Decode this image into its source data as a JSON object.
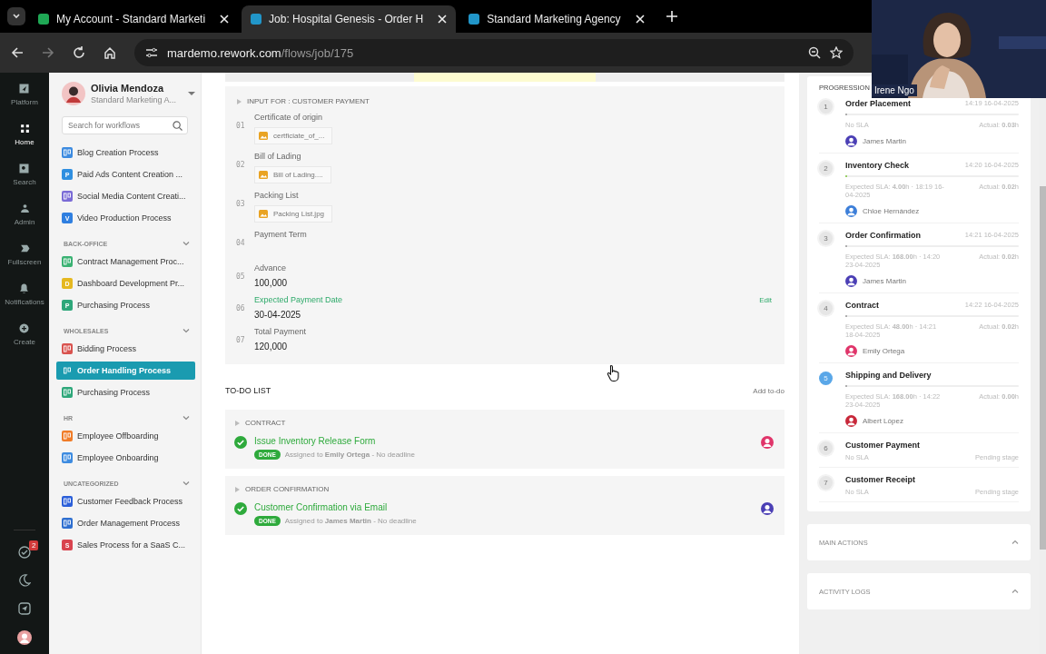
{
  "browser": {
    "tabs": [
      {
        "title": "My Account - Standard Marketi",
        "selected": false,
        "color": "#1fa855"
      },
      {
        "title": "Job: Hospital Genesis - Order H",
        "selected": true,
        "color": "#2196c9"
      },
      {
        "title": "Standard Marketing Agency",
        "selected": false,
        "color": "#2196c9"
      }
    ],
    "url": {
      "host": "mardemo.rework.com",
      "path": "/flows/job/175"
    }
  },
  "webcam": {
    "name": "Irene Ngo"
  },
  "rail": {
    "items": [
      {
        "label": "Platform",
        "selected": false
      },
      {
        "label": "Home",
        "selected": true
      },
      {
        "label": "Search",
        "selected": false
      },
      {
        "label": "Admin",
        "selected": false
      },
      {
        "label": "Fullscreen",
        "selected": false
      },
      {
        "label": "Notifications",
        "selected": false
      },
      {
        "label": "Create",
        "selected": false
      }
    ],
    "task_count": "2"
  },
  "sidebar": {
    "user": {
      "name": "Olivia Mendoza",
      "org": "Standard Marketing A..."
    },
    "search": {
      "placeholder": "Search for workflows"
    },
    "groups": [
      {
        "items": [
          {
            "label": "Blog Creation Process",
            "selected": false,
            "color": "#3d8be0"
          },
          {
            "label": "Paid Ads Content Creation ...",
            "selected": false,
            "color": "#2f8fe0",
            "letter": "P"
          },
          {
            "label": "Social Media Content Creati...",
            "selected": false,
            "color": "#7a6bd6"
          },
          {
            "label": "Video Production Process",
            "selected": false,
            "color": "#2f7fe0",
            "letter": "V"
          }
        ]
      },
      {
        "title": "BACK-OFFICE",
        "items": [
          {
            "label": "Contract Management Proc...",
            "selected": false,
            "color": "#3bb273"
          },
          {
            "label": "Dashboard Development Pr...",
            "selected": false,
            "color": "#e5b820",
            "letter": "D"
          },
          {
            "label": "Purchasing Process",
            "selected": false,
            "color": "#2ea77a",
            "letter": "P"
          }
        ]
      },
      {
        "title": "WHOLESALES",
        "items": [
          {
            "label": "Bidding Process",
            "selected": false,
            "color": "#d9534f"
          },
          {
            "label": "Order Handling Process",
            "selected": true
          },
          {
            "label": "Purchasing Process",
            "selected": false,
            "color": "#2ea77a"
          }
        ]
      },
      {
        "title": "HR",
        "items": [
          {
            "label": "Employee Offboarding",
            "selected": false,
            "color": "#f07c28"
          },
          {
            "label": "Employee Onboarding",
            "selected": false,
            "color": "#3d8be0"
          }
        ]
      },
      {
        "title": "UNCATEGORIZED",
        "items": [
          {
            "label": "Customer Feedback Process",
            "selected": false,
            "color": "#2b5fd9"
          },
          {
            "label": "Order Management Process",
            "selected": false,
            "color": "#2f6fd0"
          },
          {
            "label": "Sales Process for a SaaS C...",
            "selected": false,
            "color": "#d9444f",
            "letter": "S"
          }
        ]
      }
    ]
  },
  "input_section": {
    "title": "INPUT FOR : CUSTOMER PAYMENT",
    "fields": [
      {
        "number": "01",
        "label": "Certificate of origin",
        "kind": "file",
        "file": "certficiate_of_..."
      },
      {
        "number": "02",
        "label": "Bill of Lading",
        "kind": "file",
        "file": "Bill of Lading...."
      },
      {
        "number": "03",
        "label": "Packing List",
        "kind": "file",
        "file": "Packing List.jpg"
      },
      {
        "number": "04",
        "label": "Payment Term",
        "kind": "empty"
      },
      {
        "number": "05",
        "label": "Advance",
        "kind": "value",
        "value": "100,000"
      },
      {
        "number": "06",
        "label": "Expected Payment Date",
        "kind": "value",
        "value": "30-04-2025",
        "highlighted": true,
        "action": "Edit"
      },
      {
        "number": "07",
        "label": "Total Payment",
        "kind": "value",
        "value": "120,000"
      }
    ]
  },
  "todo": {
    "title": "TO-DO LIST",
    "add": "Add to-do",
    "groups": [
      {
        "stage": "CONTRACT",
        "items": [
          {
            "title": "Issue Inventory Release Form",
            "done": true,
            "status": "DONE",
            "assigned": "Assigned to **Emily Ortega** - No deadline",
            "color": "#e0356a"
          }
        ]
      },
      {
        "stage": "ORDER CONFIRMATION",
        "items": [
          {
            "title": "Customer Confirmation via Email",
            "done": true,
            "status": "DONE",
            "assigned": "Assigned to **James Martin** - No deadline",
            "color": "#4b3fb5"
          }
        ]
      }
    ]
  },
  "progression": {
    "title": "PROGRESSION",
    "stages": [
      {
        "number": "1",
        "name": "Order Placement",
        "current": false,
        "time": "14:19 16-04-2025",
        "level": 0,
        "sla": "No SLA",
        "actual": "Actual: **0.03**h",
        "assignee": "James Martin",
        "color": "#4b3fb5"
      },
      {
        "number": "2",
        "name": "Inventory Check",
        "current": false,
        "time": "14:20 16-04-2025",
        "level": 0.01,
        "sla": "Expected SLA: **4.00**h · 18:19 16-04-2025",
        "actual": "Actual: **0.02**h",
        "assignee": "Chloe Hernández",
        "color": "#3d7fd9"
      },
      {
        "number": "3",
        "name": "Order Confirmation",
        "current": false,
        "time": "14:21 16-04-2025",
        "level": 0.005,
        "sla": "Expected SLA: **168.00**h · 14:20 23-04-2025",
        "actual": "Actual: **0.02**h",
        "assignee": "James Martin",
        "color": "#4b3fb5"
      },
      {
        "number": "4",
        "name": "Contract",
        "current": false,
        "time": "14:22 16-04-2025",
        "level": 0.005,
        "sla": "Expected SLA: **48.00**h · 14:21 18-04-2025",
        "actual": "Actual: **0.02**h",
        "assignee": "Emily Ortega",
        "color": "#e0356a"
      },
      {
        "number": "5",
        "name": "Shipping and Delivery",
        "current": true,
        "level": 0.005,
        "sla": "Expected SLA: **168.00**h · 14:22 23-04-2025",
        "actual": "Actual: **0.00**h",
        "assignee": "Albert López",
        "color": "#c8283a"
      },
      {
        "number": "6",
        "name": "Customer Payment",
        "current": false,
        "sla": "No SLA",
        "actual": "Pending stage"
      },
      {
        "number": "7",
        "name": "Customer Receipt",
        "current": false,
        "sla": "No SLA",
        "actual": "Pending stage"
      }
    ]
  },
  "panels": [
    {
      "title": "MAIN ACTIONS"
    },
    {
      "title": "ACTIVITY LOGS"
    }
  ]
}
